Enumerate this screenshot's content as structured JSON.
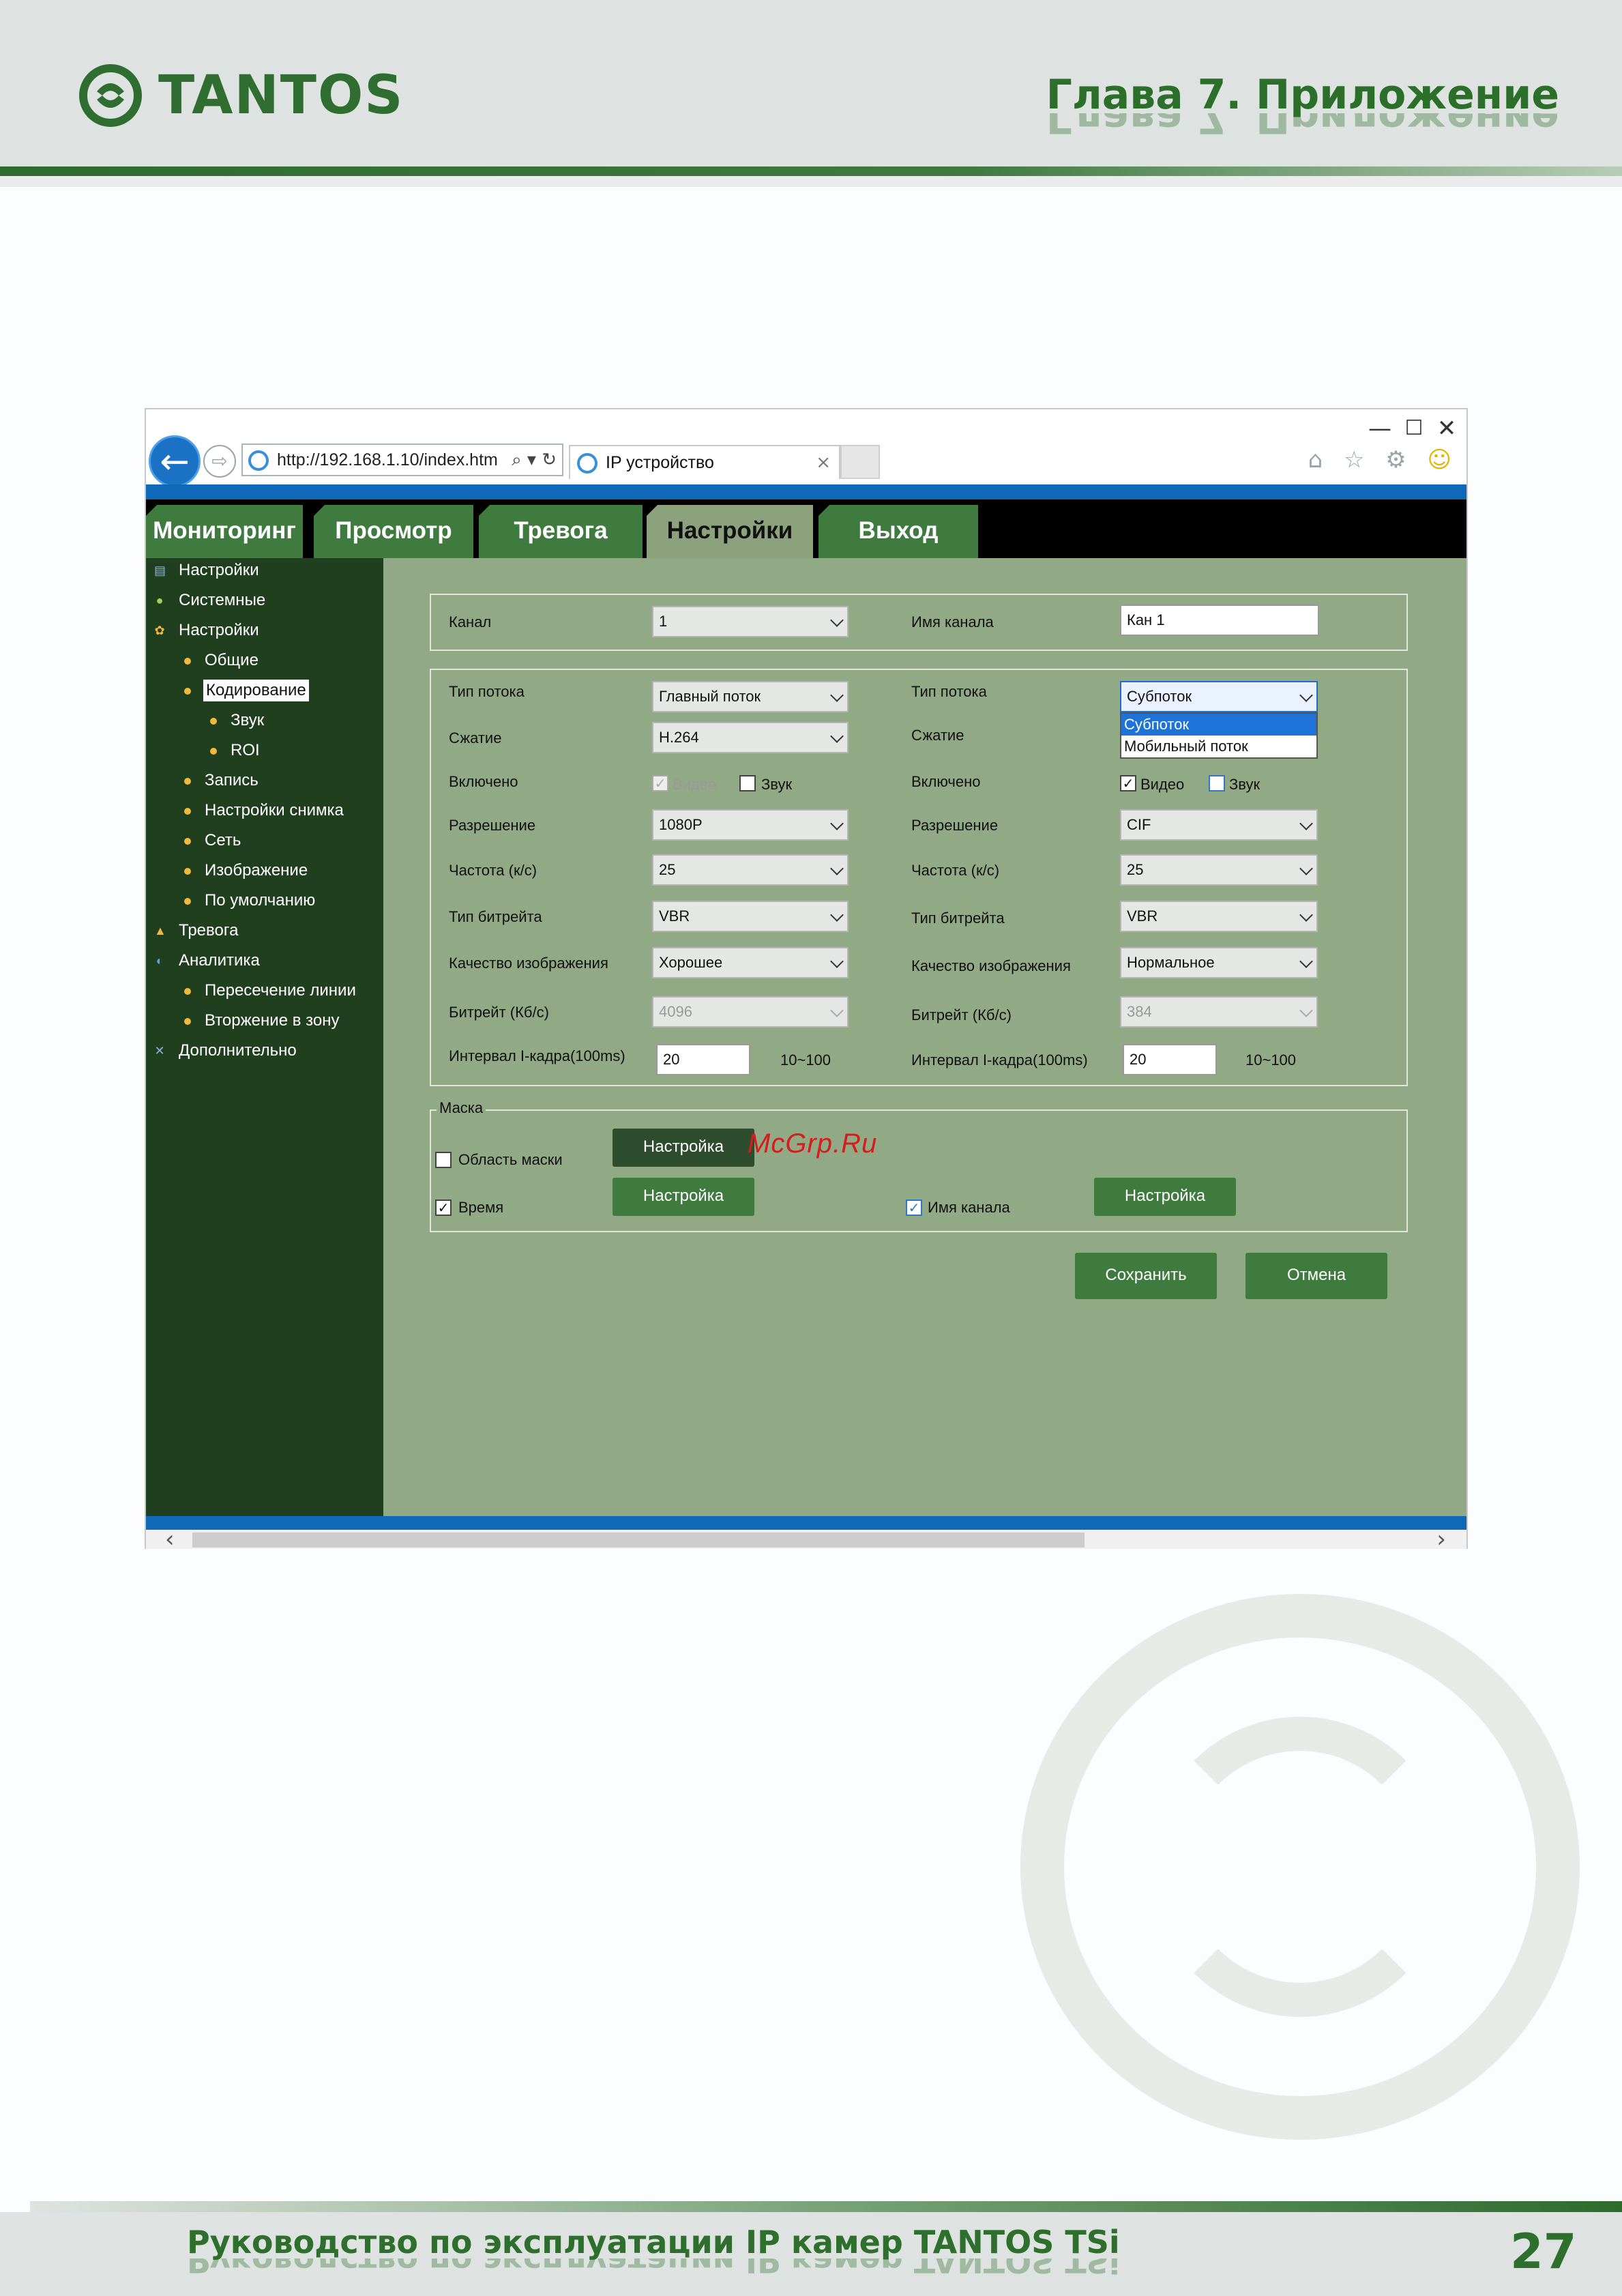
{
  "header": {
    "logo_text": "TANTOS",
    "chapter": "Глава 7. Приложение"
  },
  "browser": {
    "url": "http://192.168.1.10/index.htm",
    "url_tools": "⌕ ▾ ↻",
    "tab_title": "IP устройство",
    "tab_close": "×",
    "minimize": "—",
    "maximize": "☐",
    "close": "✕",
    "back": "←",
    "forward": "⇨",
    "toolbar_icons": "⌂ ☆ ⚙",
    "smiley": "☺",
    "scroll_left": "‹",
    "scroll_right": "›"
  },
  "nav": {
    "tabs": [
      {
        "label": "Мониторинг"
      },
      {
        "label": "Просмотр"
      },
      {
        "label": "Тревога"
      },
      {
        "label": "Настройки"
      },
      {
        "label": "Выход"
      }
    ],
    "active": "Настройки"
  },
  "sidebar": {
    "items": [
      "Настройки",
      "Системные",
      "Настройки",
      "Общие",
      "Кодирование",
      "Звук",
      "ROI",
      "Запись",
      "Настройки снимка",
      "Сеть",
      "Изображение",
      "По умолчанию",
      "Тревога",
      "Аналитика",
      "Пересечение линии",
      "Вторжение в зону",
      "Дополнительно"
    ],
    "selected": "Кодирование"
  },
  "form": {
    "channel_label": "Канал",
    "channel_value": "1",
    "channel_name_label": "Имя канала",
    "channel_name_value": "Кан 1",
    "left": {
      "stream_type_label": "Тип потока",
      "stream_type": "Главный поток",
      "compression_label": "Сжатие",
      "compression": "H.264",
      "enabled_label": "Включено",
      "video_label": "Видео",
      "video_checked": true,
      "audio_label": "Звук",
      "audio_checked": false,
      "resolution_label": "Разрешение",
      "resolution": "1080P",
      "fps_label": "Частота (к/с)",
      "fps": "25",
      "bitrate_type_label": "Тип битрейта",
      "bitrate_type": "VBR",
      "quality_label": "Качество изображения",
      "quality": "Хорошее",
      "bitrate_label": "Битрейт (Кб/с)",
      "bitrate": "4096",
      "iframe_label": "Интервал I-кадра(100ms)",
      "iframe": "20",
      "iframe_range": "10~100"
    },
    "right": {
      "stream_type_label": "Тип потока",
      "stream_type": "Субпоток",
      "stream_options": [
        "Субпоток",
        "Мобильный поток"
      ],
      "compression_label": "Сжатие",
      "enabled_label": "Включено",
      "video_label": "Видео",
      "video_checked": true,
      "audio_label": "Звук",
      "audio_checked": false,
      "resolution_label": "Разрешение",
      "resolution": "CIF",
      "fps_label": "Частота (к/с)",
      "fps": "25",
      "bitrate_type_label": "Тип битрейта",
      "bitrate_type": "VBR",
      "quality_label": "Качество изображения",
      "quality": "Нормальное",
      "bitrate_label": "Битрейт (Кб/с)",
      "bitrate": "384",
      "iframe_label": "Интервал I-кадра(100ms)",
      "iframe": "20",
      "iframe_range": "10~100"
    },
    "mask": {
      "legend": "Маска",
      "area_mask_label": "Область маски",
      "area_mask_checked": false,
      "time_label": "Время",
      "time_checked": true,
      "channel_name_label": "Имя канала",
      "channel_name_checked": true,
      "setup_label": "Настройка"
    },
    "save_label": "Сохранить",
    "cancel_label": "Отмена",
    "check_mark": "✓"
  },
  "watermark_text": "McGrp.Ru",
  "footer": {
    "text": "Руководство по эксплуатации IP камер TANTOS TSi",
    "page_number": "27"
  }
}
